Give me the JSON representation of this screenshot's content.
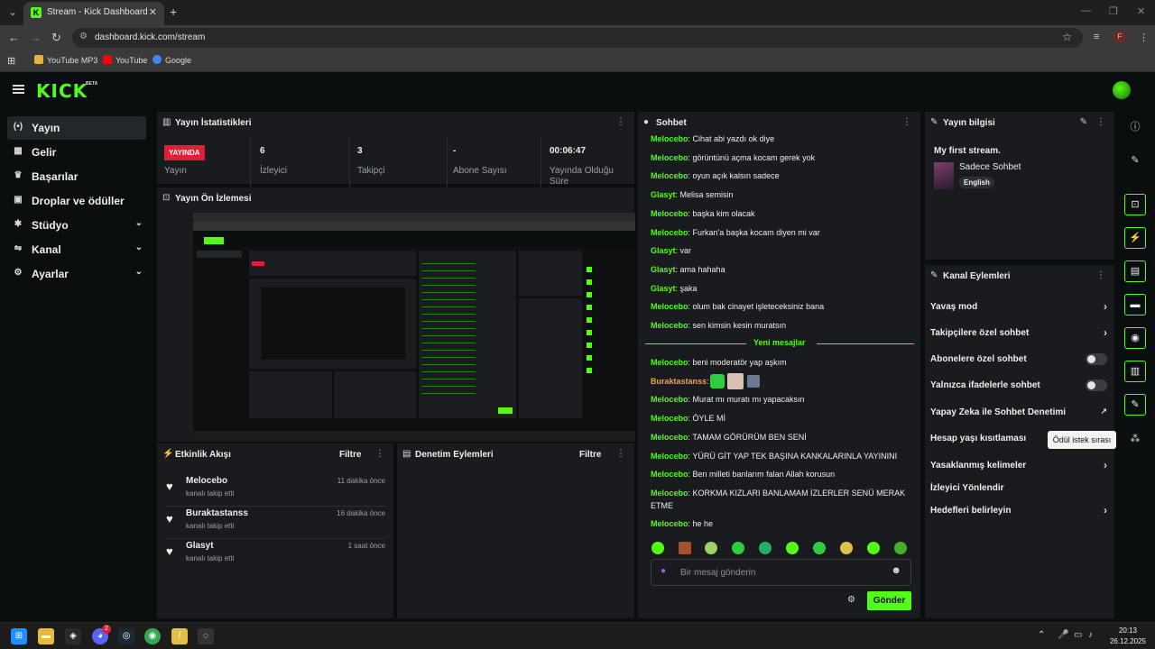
{
  "browser": {
    "tab_title": "Stream - Kick Dashboard",
    "url": "dashboard.kick.com/stream",
    "bookmarks": [
      "YouTube MP3",
      "YouTube",
      "Google"
    ],
    "profile_initial": "F"
  },
  "header": {
    "logo": "KICK",
    "badge": "BETA"
  },
  "sidebar": {
    "items": [
      {
        "label": "Yayın",
        "icon": "broadcast-icon",
        "glyph": "(•)",
        "active": true
      },
      {
        "label": "Gelir",
        "icon": "revenue-icon",
        "glyph": "▦",
        "active": false
      },
      {
        "label": "Başarılar",
        "icon": "trophy-icon",
        "glyph": "🏆",
        "active": false
      },
      {
        "label": "Droplar ve ödüller",
        "icon": "drops-icon",
        "glyph": "🎁",
        "active": false
      },
      {
        "label": "Stüdyo",
        "icon": "studio-icon",
        "glyph": "✱",
        "active": false,
        "expandable": true
      },
      {
        "label": "Kanal",
        "icon": "channel-icon",
        "glyph": "⇋",
        "active": false,
        "expandable": true
      },
      {
        "label": "Ayarlar",
        "icon": "settings-icon",
        "glyph": "⚙",
        "active": false,
        "expandable": true
      }
    ]
  },
  "stats": {
    "title": "Yayın İstatistikleri",
    "live_badge": "YAYINDA",
    "cells": [
      {
        "value": "",
        "label": "Yayın"
      },
      {
        "value": "6",
        "label": "İzleyici"
      },
      {
        "value": "3",
        "label": "Takipçi"
      },
      {
        "value": "-",
        "label": "Abone Sayısı"
      },
      {
        "value": "00:06:47",
        "label": "Yayında Olduğu Süre"
      }
    ]
  },
  "preview": {
    "title": "Yayın Ön İzlemesi"
  },
  "activity": {
    "title": "Etkinlik Akışı",
    "filter": "Filtre",
    "items": [
      {
        "name": "Melocebo",
        "sub": "kanalı takip etti",
        "time": "11 dakika önce"
      },
      {
        "name": "Buraktastanss",
        "sub": "kanalı takip etti",
        "time": "16 dakika önce"
      },
      {
        "name": "Glasyt",
        "sub": "kanalı takip etti",
        "time": "1 saat önce"
      }
    ]
  },
  "moderation": {
    "title": "Denetim Eylemleri",
    "filter": "Filtre"
  },
  "chat": {
    "title": "Sohbet",
    "messages_before": [
      {
        "user": "Melocebo",
        "color": "#53fc18",
        "text": "Cihat abi yazdı ok diye"
      },
      {
        "user": "Melocebo",
        "color": "#53fc18",
        "text": "görüntünü açma kocam gerek yok"
      },
      {
        "user": "Melocebo",
        "color": "#53fc18",
        "text": "oyun açık kalsın sadece"
      },
      {
        "user": "Glasyt",
        "color": "#53fc18",
        "text": "Melisa semisin"
      },
      {
        "user": "Melocebo",
        "color": "#53fc18",
        "text": "başka kim olacak"
      },
      {
        "user": "Melocebo",
        "color": "#53fc18",
        "text": "Furkan'a başka kocam diyen mi var"
      },
      {
        "user": "Glasyt",
        "color": "#53fc18",
        "text": "var"
      },
      {
        "user": "Glasyt",
        "color": "#53fc18",
        "text": "ama hahaha"
      },
      {
        "user": "Glasyt",
        "color": "#53fc18",
        "text": "şaka"
      },
      {
        "user": "Melocebo",
        "color": "#53fc18",
        "text": "olum bak cinayet işleteceksiniz bana"
      },
      {
        "user": "Melocebo",
        "color": "#53fc18",
        "text": "sen kimsin kesin muratsın"
      }
    ],
    "new_messages_label": "Yeni mesajlar",
    "messages_after": [
      {
        "user": "Melocebo",
        "color": "#53fc18",
        "text": "beni moderatör yap aşkım"
      },
      {
        "user": "Buraktastanss",
        "color": "#f5a623",
        "text": ""
      },
      {
        "user": "Melocebo",
        "color": "#53fc18",
        "text": "Murat mı muratı mı yapacaksın"
      },
      {
        "user": "Melocebo",
        "color": "#53fc18",
        "text": "ÖYLE Mİ"
      },
      {
        "user": "Melocebo",
        "color": "#53fc18",
        "text": "TAMAM GÖRÜRÜM BEN SENİ"
      },
      {
        "user": "Melocebo",
        "color": "#53fc18",
        "text": "YÜRÜ GİT YAP TEK BAŞINA KANKALARINLA YAYININI"
      },
      {
        "user": "Melocebo",
        "color": "#53fc18",
        "text": "Ben milleti banlarım falan Allah korusun"
      },
      {
        "user": "Melocebo",
        "color": "#53fc18",
        "text": "KORKMA KIZLARI BANLAMAM İZLERLER SENÜ MERAK ETME"
      },
      {
        "user": "Melocebo",
        "color": "#53fc18",
        "text": "he he"
      }
    ],
    "input_placeholder": "Bir mesaj gönderin",
    "send_label": "Gönder"
  },
  "stream_info": {
    "title": "Yayın bilgisi",
    "stream_title": "My first stream.",
    "category": "Sadece Sohbet",
    "language": "English"
  },
  "channel_actions": {
    "title": "Kanal Eylemleri",
    "items": [
      {
        "label": "Yavaş mod",
        "control": "chevron"
      },
      {
        "label": "Takipçilere özel sohbet",
        "control": "chevron"
      },
      {
        "label": "Abonelere özel sohbet",
        "control": "toggle"
      },
      {
        "label": "Yalnızca ifadelerle sohbet",
        "control": "toggle"
      },
      {
        "label": "Yapay Zeka ile Sohbet Denetimi",
        "control": "external"
      },
      {
        "label": "Hesap yaşı kısıtlaması",
        "control": "none"
      },
      {
        "label": "Yasaklanmış kelimeler",
        "control": "chevron"
      },
      {
        "label": "İzleyici Yönlendir",
        "control": "none"
      },
      {
        "label": "Hedefleri belirleyin",
        "control": "chevron"
      }
    ]
  },
  "rail": {
    "tooltip": "Ödül istek sırası"
  },
  "taskbar": {
    "time": "20:13",
    "date": "26.12.2025",
    "discord_badge": "2"
  },
  "colors": {
    "accent": "#53fc18",
    "live": "#e01e37",
    "panel": "#191b1f",
    "bg": "#0b0e0f"
  }
}
